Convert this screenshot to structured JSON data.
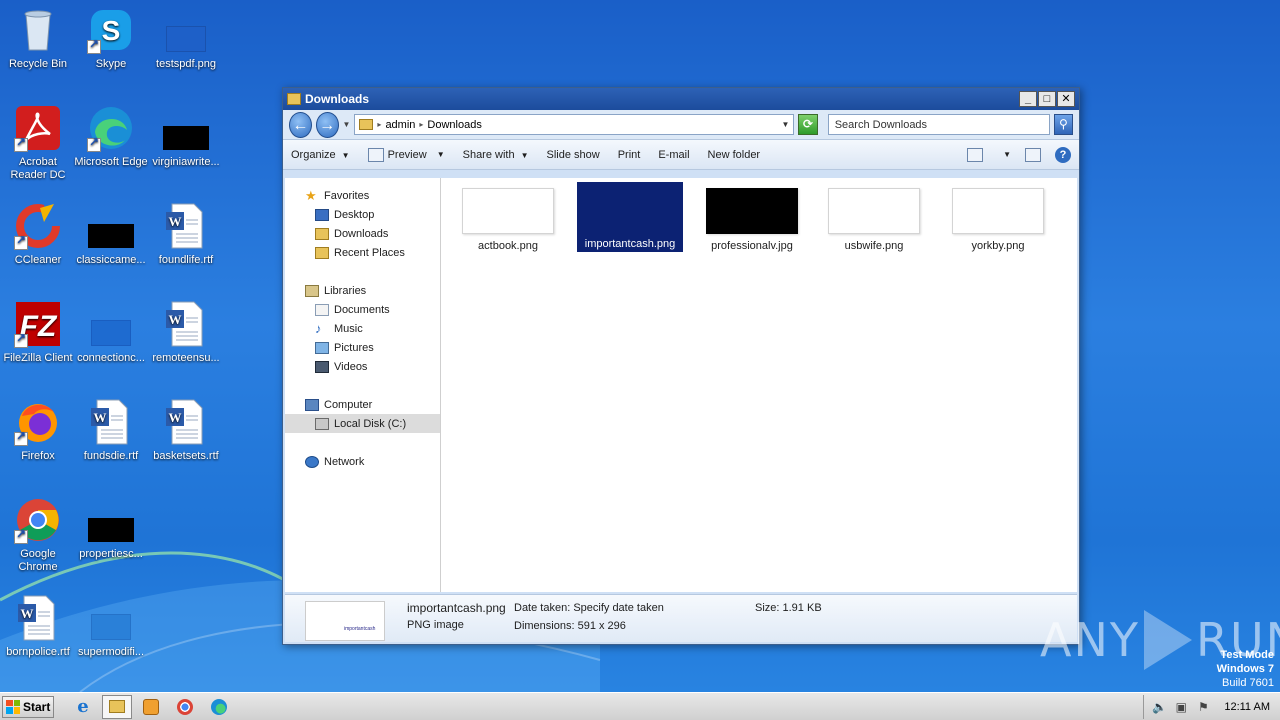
{
  "desktop": {
    "icons": [
      {
        "label": "Recycle Bin"
      },
      {
        "label": "Skype"
      },
      {
        "label": "testspdf.png"
      },
      {
        "label": "Acrobat Reader DC"
      },
      {
        "label": "Microsoft Edge"
      },
      {
        "label": "virginiawrite..."
      },
      {
        "label": "CCleaner"
      },
      {
        "label": "classiccame..."
      },
      {
        "label": "foundlife.rtf"
      },
      {
        "label": "FileZilla Client"
      },
      {
        "label": "connectionc..."
      },
      {
        "label": "remoteensu..."
      },
      {
        "label": "Firefox"
      },
      {
        "label": "fundsdie.rtf"
      },
      {
        "label": "basketsets.rtf"
      },
      {
        "label": "Google Chrome"
      },
      {
        "label": "propertiesc..."
      },
      {
        "label": "bornpolice.rtf"
      },
      {
        "label": "supermodifi..."
      }
    ]
  },
  "window": {
    "title": "Downloads",
    "address": {
      "segments": [
        "admin",
        "Downloads"
      ]
    },
    "search": {
      "placeholder": "Search Downloads"
    },
    "toolbar": {
      "organize": "Organize",
      "preview": "Preview",
      "share_with": "Share with",
      "slide_show": "Slide show",
      "print": "Print",
      "email": "E-mail",
      "new_folder": "New folder"
    },
    "nav": {
      "favorites": "Favorites",
      "desktop": "Desktop",
      "downloads": "Downloads",
      "recent_places": "Recent Places",
      "libraries": "Libraries",
      "documents": "Documents",
      "music": "Music",
      "pictures": "Pictures",
      "videos": "Videos",
      "computer": "Computer",
      "local_disk": "Local Disk (C:)",
      "network": "Network"
    },
    "files": [
      {
        "name": "actbook.png"
      },
      {
        "name": "importantcash.png"
      },
      {
        "name": "professionalv.jpg"
      },
      {
        "name": "usbwife.png"
      },
      {
        "name": "yorkby.png"
      }
    ],
    "details": {
      "name": "importantcash.png",
      "type": "PNG image",
      "date_taken": "Date taken: Specify date taken",
      "dimensions": "Dimensions: 591 x 296",
      "size": "Size: 1.91 KB",
      "thumb_text": "importantcash"
    }
  },
  "watermark": {
    "text_left": "ANY",
    "text_right": "RUN"
  },
  "test_mode": {
    "line1": "Test Mode",
    "line2": "Windows 7",
    "line3": "Build 7601"
  },
  "taskbar": {
    "start": "Start",
    "clock": "12:11 AM"
  }
}
